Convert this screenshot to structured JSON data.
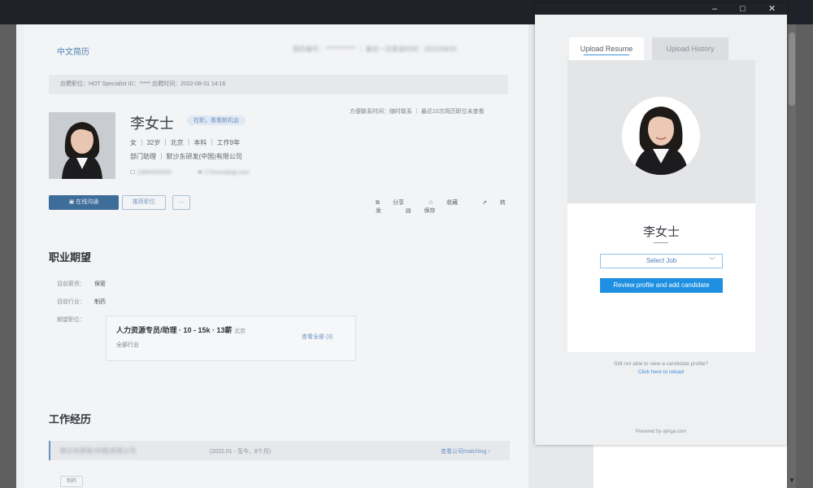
{
  "window": {
    "minimize": "–",
    "maximize": "□",
    "close": "✕"
  },
  "resume": {
    "tab_label": "中文简历",
    "header_meta": "简历编号：************ ｜ 最近一次登录时间：2022/09/20",
    "notice": "应聘职位：HOT Specialist ID：***** 应聘时间：2022-08-31 14:16",
    "name": "李女士",
    "status_tag": "在职，看看新机会",
    "line1": "女 ｜ 32岁 ｜ 北京 ｜ 本科 ｜ 工作9年",
    "line2": "部门助理 ｜ 默沙东研发(中国)有限公司",
    "phone": "13800000000",
    "email": "173xxxx@qq.com",
    "right_meta": "方便联系时间：随时联系 ｜ 最近10次简历职位未查看",
    "buttons": {
      "contact": "在线沟通",
      "recommend": "推荐职位",
      "more": "···"
    },
    "actions": [
      "分享",
      "收藏",
      "转发",
      "保存"
    ],
    "career_title": "职业期望",
    "career": [
      {
        "k": "目前薪资：",
        "v": "保密"
      },
      {
        "k": "目前行业：",
        "v": "制药"
      }
    ],
    "expected_label": "期望职位：",
    "job_card": {
      "title": "人力资源专员/助理 · 10 - 15k · 13薪",
      "title_suffix": "北京",
      "subtitle": "全部行业",
      "link": "查看全部 (3)"
    },
    "work_title": "工作经历",
    "experience": {
      "company": "默沙东研发(中国)有限公司",
      "dates": "(2022.01 - 至今，8个月)",
      "link": "查看公司matching ›",
      "chip": "制药"
    }
  },
  "panel": {
    "tab_upload": "Upload Resume",
    "tab_history": "Upload History",
    "name": "李女士",
    "select_job": "Select Job",
    "review_button": "Review profile and add candidate",
    "help_text": "Still not able to view a candidate profile?",
    "help_link": "Click here to reload",
    "powered_by": "Powered by ajinga.com"
  },
  "colors": {
    "accent": "#1e8fe1",
    "topbar": "#1f2329",
    "overlay": "#5f5f5f"
  }
}
